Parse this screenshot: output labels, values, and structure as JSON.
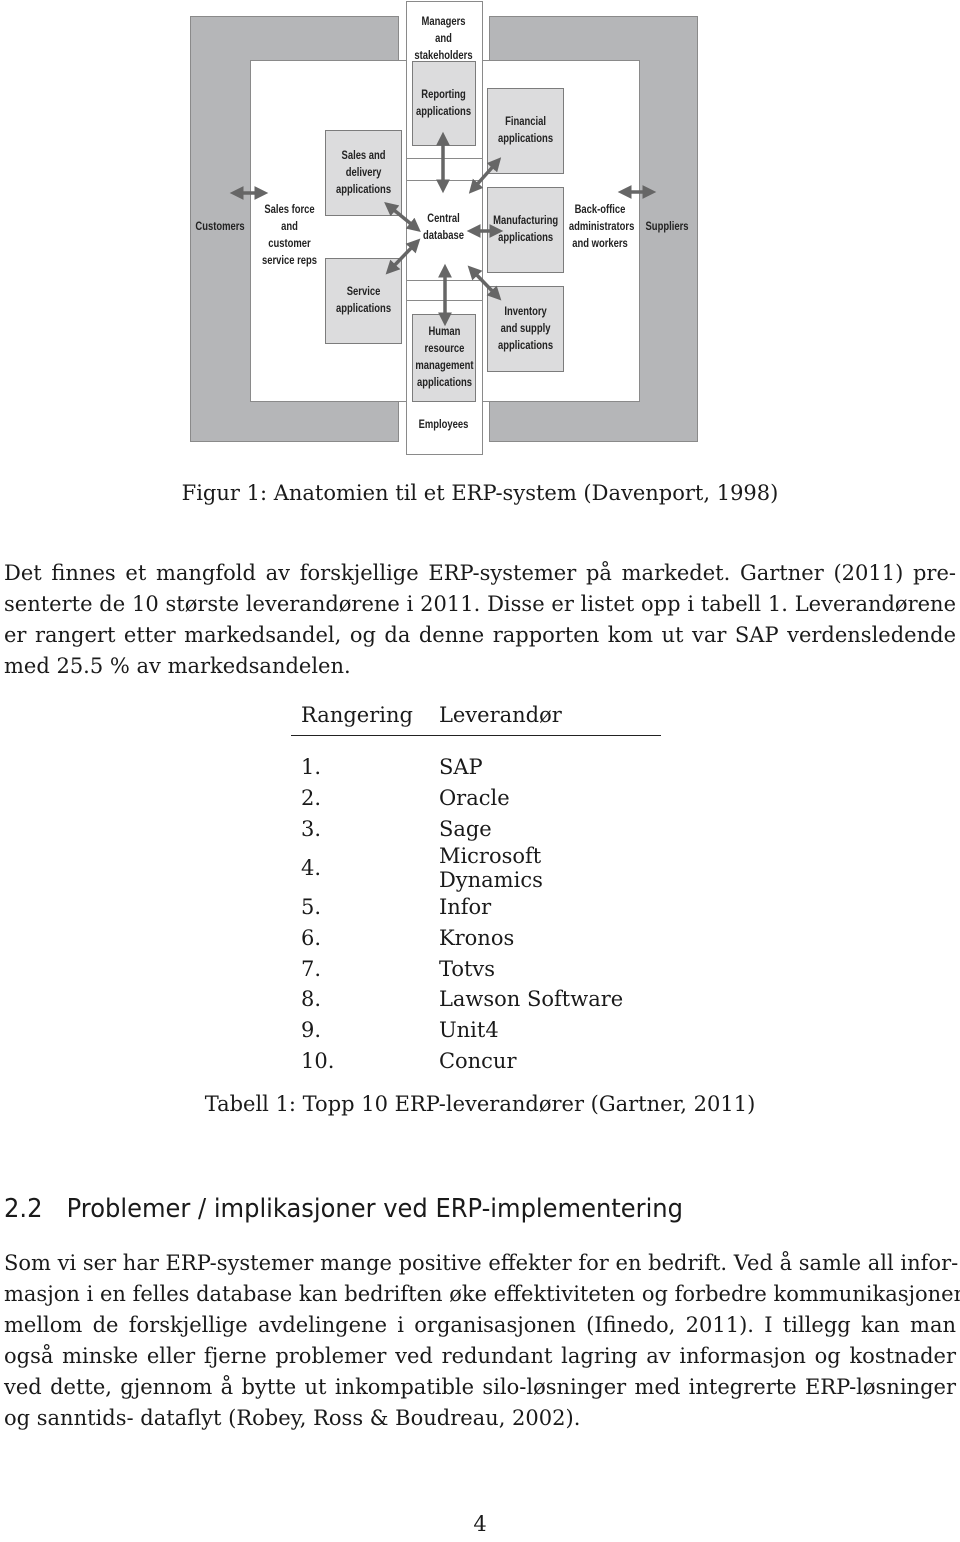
{
  "figure": {
    "labels": {
      "managers": "Managers and\nstakeholders",
      "reporting": "Reporting\napplications",
      "financial": "Financial\napplications",
      "sales_delivery": "Sales and\ndelivery\napplications",
      "customers": "Customers",
      "sales_force": "Sales force\nand customer\nservice reps",
      "central_db": "Central\ndatabase",
      "manufacturing": "Manufacturing\napplications",
      "back_office": "Back-office\nadministrators\nand workers",
      "suppliers": "Suppliers",
      "service": "Service\napplications",
      "inventory": "Inventory\nand supply\napplications",
      "hr": "Human\nresource\nmanagement\napplications",
      "employees": "Employees"
    },
    "caption": "Figur 1: Anatomien til et ERP-system (Davenport, 1998)"
  },
  "intro_paragraph": {
    "lines": [
      "Det finnes et mangfold av forskjellige ERP-systemer på markedet. Gartner (2011) pre-",
      "senterte de 10 største leverandørene i 2011. Disse er listet opp i tabell 1. Leverandørene",
      "er rangert etter markedsandel, og da denne rapporten kom ut var SAP verdensledende",
      "med 25.5 % av markedsandelen."
    ]
  },
  "vendor_table": {
    "headers": [
      "Rangering",
      "Leverandør"
    ],
    "rows": [
      {
        "rank": "1.",
        "vendor": "SAP"
      },
      {
        "rank": "2.",
        "vendor": "Oracle"
      },
      {
        "rank": "3.",
        "vendor": "Sage"
      },
      {
        "rank": "4.",
        "vendor": "Microsoft Dynamics"
      },
      {
        "rank": "5.",
        "vendor": "Infor"
      },
      {
        "rank": "6.",
        "vendor": "Kronos"
      },
      {
        "rank": "7.",
        "vendor": "Totvs"
      },
      {
        "rank": "8.",
        "vendor": "Lawson Software"
      },
      {
        "rank": "9.",
        "vendor": "Unit4"
      },
      {
        "rank": "10.",
        "vendor": "Concur"
      }
    ],
    "caption": "Tabell 1: Topp 10 ERP-leverandører (Gartner, 2011)"
  },
  "section": {
    "number": "2.2",
    "title": "Problemer / implikasjoner ved ERP-implementering"
  },
  "section_paragraph": {
    "lines": [
      "Som vi ser har ERP-systemer mange positive effekter for en bedrift. Ved å samle all infor-",
      "masjon i en felles database kan bedriften øke effektiviteten og forbedre kommunikasjonen",
      "mellom de forskjellige avdelingene i organisasjonen (Ifinedo, 2011). I tillegg kan man",
      "også minske eller fjerne problemer ved redundant lagring av informasjon og kostnader",
      "ved dette, gjennom å bytte ut inkompatible silo-løsninger med integrerte ERP-løsninger",
      "og sanntids- dataflyt (Robey, Ross & Boudreau, 2002)."
    ]
  },
  "page_number": "4"
}
